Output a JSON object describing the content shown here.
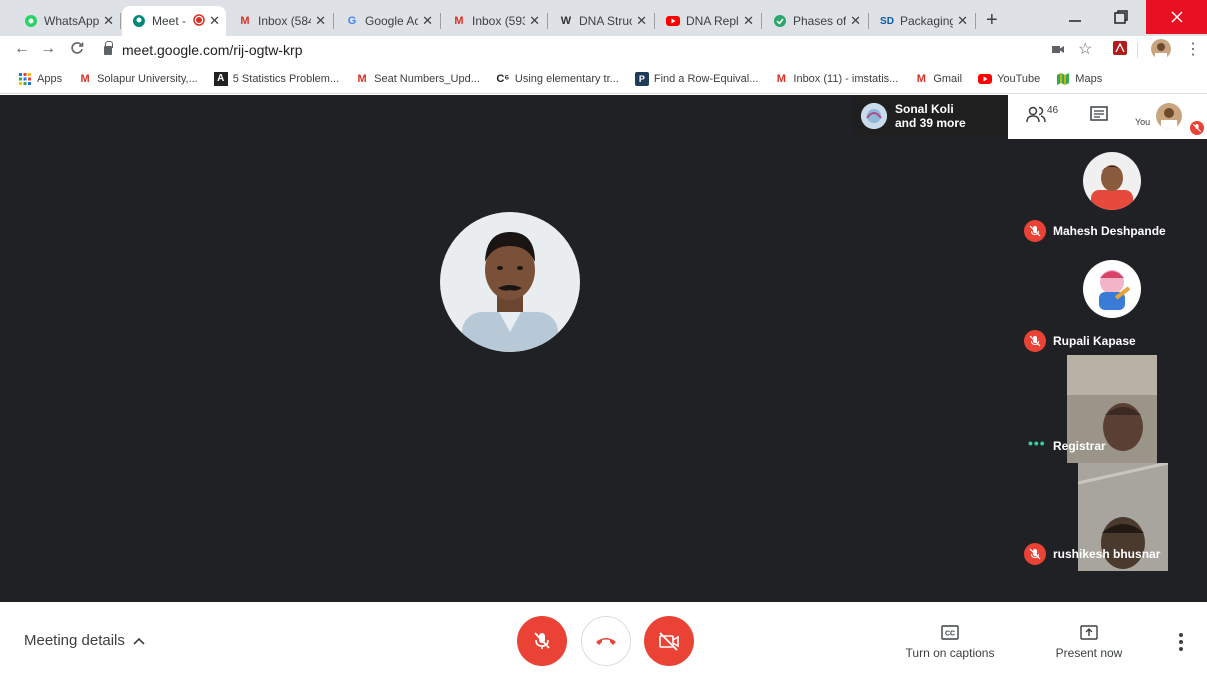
{
  "browser": {
    "tabs": [
      {
        "label": "WhatsApp",
        "icon": "whatsapp-icon",
        "color": "#25d366"
      },
      {
        "label": "Meet -",
        "icon": "meet-icon",
        "color": "#00897b",
        "recording": true
      },
      {
        "label": "Inbox (584",
        "icon": "gmail-icon",
        "color": "#d93025"
      },
      {
        "label": "Google Ac",
        "icon": "google-icon",
        "color": "#4285f4"
      },
      {
        "label": "Inbox (593",
        "icon": "gmail-icon",
        "color": "#d93025"
      },
      {
        "label": "DNA Struc",
        "icon": "dna-icon",
        "color": "#333333"
      },
      {
        "label": "DNA Repli",
        "icon": "youtube-icon",
        "color": "#ff0000"
      },
      {
        "label": "Phases of",
        "icon": "phases-icon",
        "color": "#2ba56a"
      },
      {
        "label": "Packaging",
        "icon": "sd-icon",
        "color": "#0a5aa8"
      }
    ],
    "url": "meet.google.com/rij-ogtw-krp",
    "bookmarks": [
      {
        "label": "Apps",
        "icon": "apps-grid-icon"
      },
      {
        "label": "Solapur University,...",
        "icon": "gmail-icon"
      },
      {
        "label": "5 Statistics Problem...",
        "icon": "statistics-icon"
      },
      {
        "label": "Seat Numbers_Upd...",
        "icon": "gmail-icon"
      },
      {
        "label": "Using elementary tr...",
        "icon": "chegg-icon"
      },
      {
        "label": "Find a Row-Equival...",
        "icon": "find-icon"
      },
      {
        "label": "Inbox (11) - imstatis...",
        "icon": "gmail-icon"
      },
      {
        "label": "Gmail",
        "icon": "gmail-icon"
      },
      {
        "label": "YouTube",
        "icon": "youtube-icon"
      },
      {
        "label": "Maps",
        "icon": "maps-icon"
      }
    ]
  },
  "meet": {
    "presenter_chip": {
      "line1": "Sonal Koli",
      "line2": "and 39 more"
    },
    "participant_count": "46",
    "you_label": "You",
    "participants": [
      {
        "name": "Mahesh Deshpande",
        "muted": true,
        "type": "avatar"
      },
      {
        "name": "Rupali Kapase",
        "muted": true,
        "type": "avatar"
      },
      {
        "name": "Registrar",
        "muted": false,
        "type": "video"
      },
      {
        "name": "rushikesh bhusnar",
        "muted": true,
        "type": "video"
      }
    ],
    "meeting_details_label": "Meeting details",
    "captions_label": "Turn on captions",
    "present_label": "Present now",
    "colors": {
      "stage": "#202124",
      "danger": "#ea4335"
    }
  }
}
